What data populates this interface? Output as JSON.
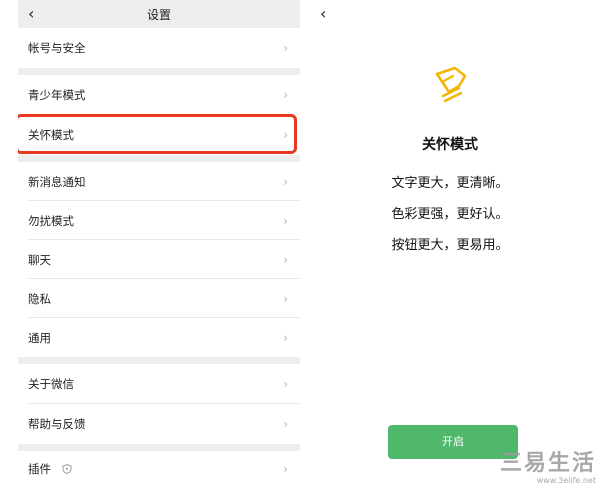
{
  "left": {
    "title": "设置",
    "back_icon": "chevron-left-icon",
    "items": [
      {
        "label": "帐号与安全"
      },
      {
        "label": "青少年模式"
      },
      {
        "label": "关怀模式"
      },
      {
        "label": "新消息通知"
      },
      {
        "label": "勿扰模式"
      },
      {
        "label": "聊天"
      },
      {
        "label": "隐私"
      },
      {
        "label": "通用"
      },
      {
        "label": "关于微信"
      },
      {
        "label": "帮助与反馈"
      },
      {
        "label": "插件"
      }
    ],
    "highlight_color": "#e8381f"
  },
  "right": {
    "back_icon": "chevron-left-icon",
    "care_title": "关怀模式",
    "lines": [
      "文字更大，更清晰。",
      "色彩更强，更好认。",
      "按钮更大，更易用。"
    ],
    "button_label": "开启",
    "icon_color": "#f2b705",
    "button_color": "#4fb86b"
  },
  "watermark": {
    "big": "三易生活",
    "small": "www.3elife.net"
  }
}
